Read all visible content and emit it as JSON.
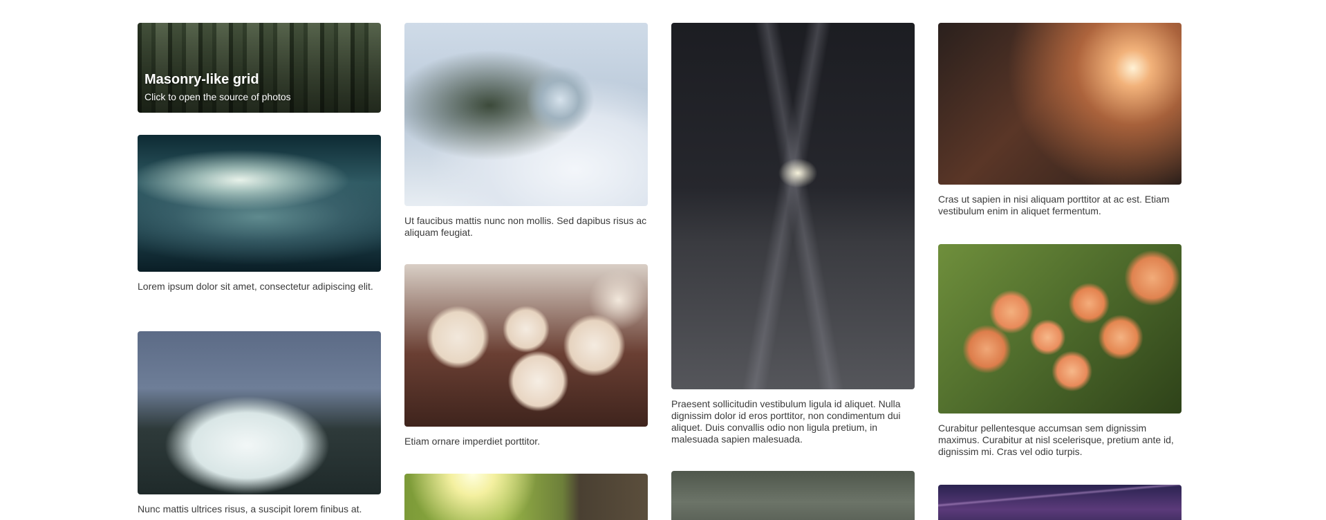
{
  "hero": {
    "title": "Masonry-like grid",
    "subtitle": "Click to open the source of photos"
  },
  "captions": {
    "sky": "Lorem ipsum dolor sit amet, consectetur adipiscing elit.",
    "writing": "Nunc mattis ultrices risus, a suscipit lorem finibus at.",
    "snow": "Ut faucibus mattis nunc non mollis. Sed dapibus risus ac aliquam feugiat.",
    "cupcakes": "Etiam ornare imperdiet porttitor.",
    "street": "Praesent sollicitudin vestibulum ligula id aliquet. Nulla dignissim dolor id eros porttitor, non condimentum dui aliquet. Duis convallis odio non ligula pretium, in malesuada sapien malesuada.",
    "bulb": "Cras ut sapien in nisi aliquam porttitor at ac est. Etiam vestibulum enim in aliquet fermentum.",
    "currants": "Curabitur pellentesque accumsan sem dignissim maximus. Curabitur at nisl scelerisque, pretium ante id, dignissim mi. Cras vel odio turpis."
  },
  "icons": {
    "photos": [
      "forest-photo",
      "sky-photo",
      "writing-photo",
      "snowflake-photo",
      "cupcakes-photo",
      "sunlit-leaves-photo",
      "night-street-photo",
      "foggy-forest-photo",
      "light-bulb-photo",
      "currants-photo",
      "bridge-photo"
    ]
  }
}
